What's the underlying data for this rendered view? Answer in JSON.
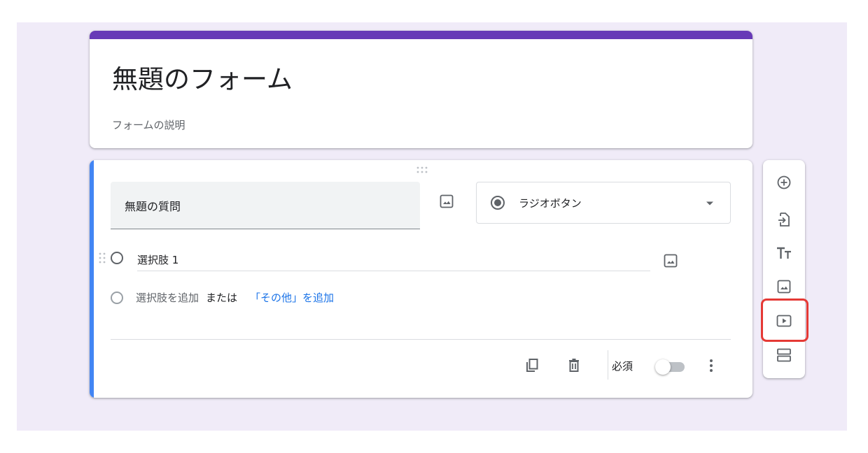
{
  "form": {
    "title": "無題のフォーム",
    "description": "フォームの説明"
  },
  "question": {
    "title": "無題の質問",
    "type": "ラジオボタン",
    "options": [
      "選択肢 1"
    ],
    "add_option": "選択肢を追加",
    "or": "または",
    "add_other": "「その他」を追加",
    "required_label": "必須",
    "required": false
  },
  "toolbar": {
    "items": [
      "add-question",
      "import-questions",
      "add-title",
      "add-image",
      "add-video",
      "add-section"
    ],
    "highlighted": "add-video"
  },
  "colors": {
    "theme": "#673ab7",
    "active_bar": "#4285f4",
    "background": "#f0ebf8",
    "link": "#1a73e8",
    "highlight": "#e53935"
  }
}
